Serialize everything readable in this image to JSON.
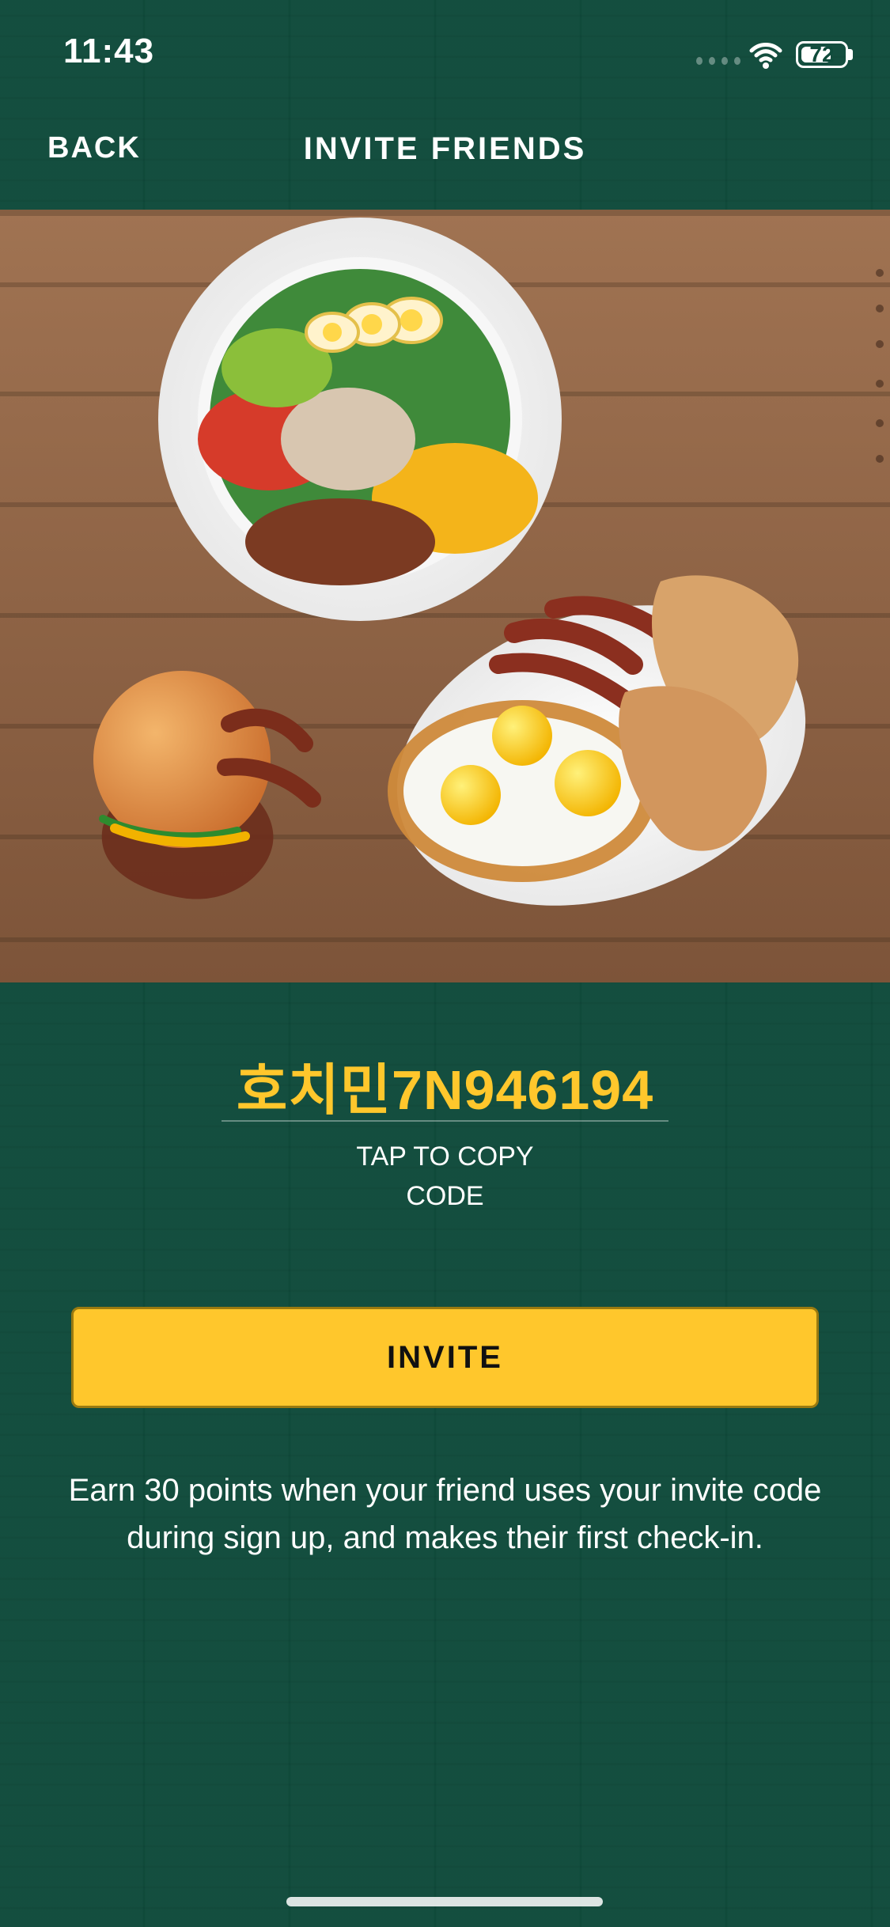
{
  "status_bar": {
    "time": "11:43",
    "battery_percent": 72,
    "battery_text": "72",
    "icons": [
      "signal-dots-icon",
      "wifi-icon",
      "battery-icon"
    ]
  },
  "nav": {
    "back_label": "BACK",
    "title": "INVITE FRIENDS"
  },
  "hero": {
    "image": "food-spread-image",
    "colors": {
      "wood": "#8b5d3e",
      "wood_dark": "#6e4a31"
    }
  },
  "invite": {
    "code": "호치민7N946194",
    "tap_to_copy_lines": [
      "TAP TO COPY",
      "CODE"
    ],
    "button_label": "INVITE",
    "earn_text": "Earn 30 points when your friend uses your invite code during sign up, and makes their first check-in."
  },
  "colors": {
    "background": "#0f4b3b",
    "accent": "#ffc72c",
    "text": "#ffffff"
  }
}
